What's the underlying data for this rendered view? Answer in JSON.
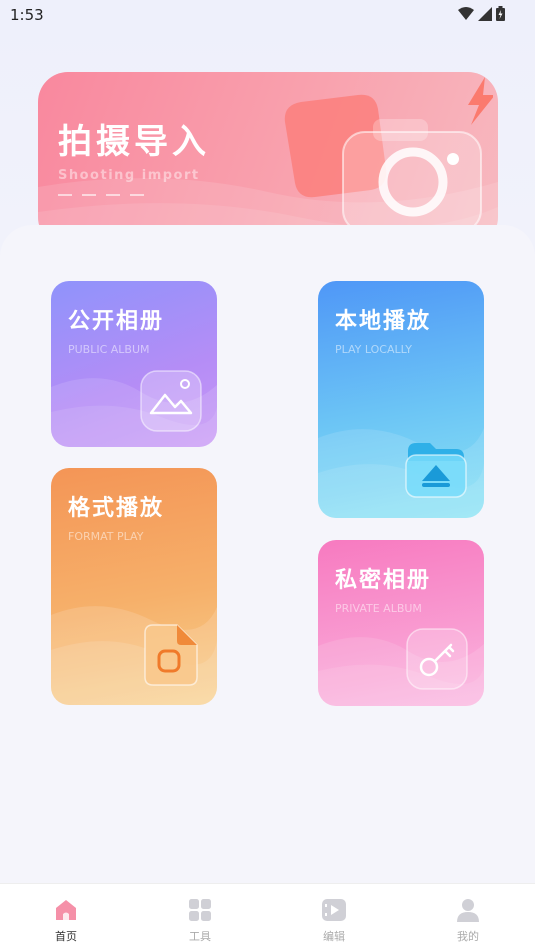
{
  "status": {
    "time": "1:53"
  },
  "banner": {
    "title": "拍摄导入",
    "subtitle": "Shooting import"
  },
  "cards": {
    "public_album": {
      "title": "公开相册",
      "subtitle": "PUBLIC ALBUM"
    },
    "play_locally": {
      "title": "本地播放",
      "subtitle": "PLAY LOCALLY"
    },
    "format_play": {
      "title": "格式播放",
      "subtitle": "FORMAT PLAY"
    },
    "private_album": {
      "title": "私密相册",
      "subtitle": "PRIVATE ALBUM"
    }
  },
  "nav": {
    "items": [
      {
        "label": "首页",
        "icon": "home-icon",
        "active": true
      },
      {
        "label": "工具",
        "icon": "grid-icon",
        "active": false
      },
      {
        "label": "编辑",
        "icon": "video-edit-icon",
        "active": false
      },
      {
        "label": "我的",
        "icon": "user-icon",
        "active": false
      }
    ]
  },
  "colors": {
    "banner": "#f9889e",
    "public_album": "#9b8cf7",
    "play_locally": "#5aa9f7",
    "format_play": "#f5a860",
    "private_album": "#f585c4"
  }
}
